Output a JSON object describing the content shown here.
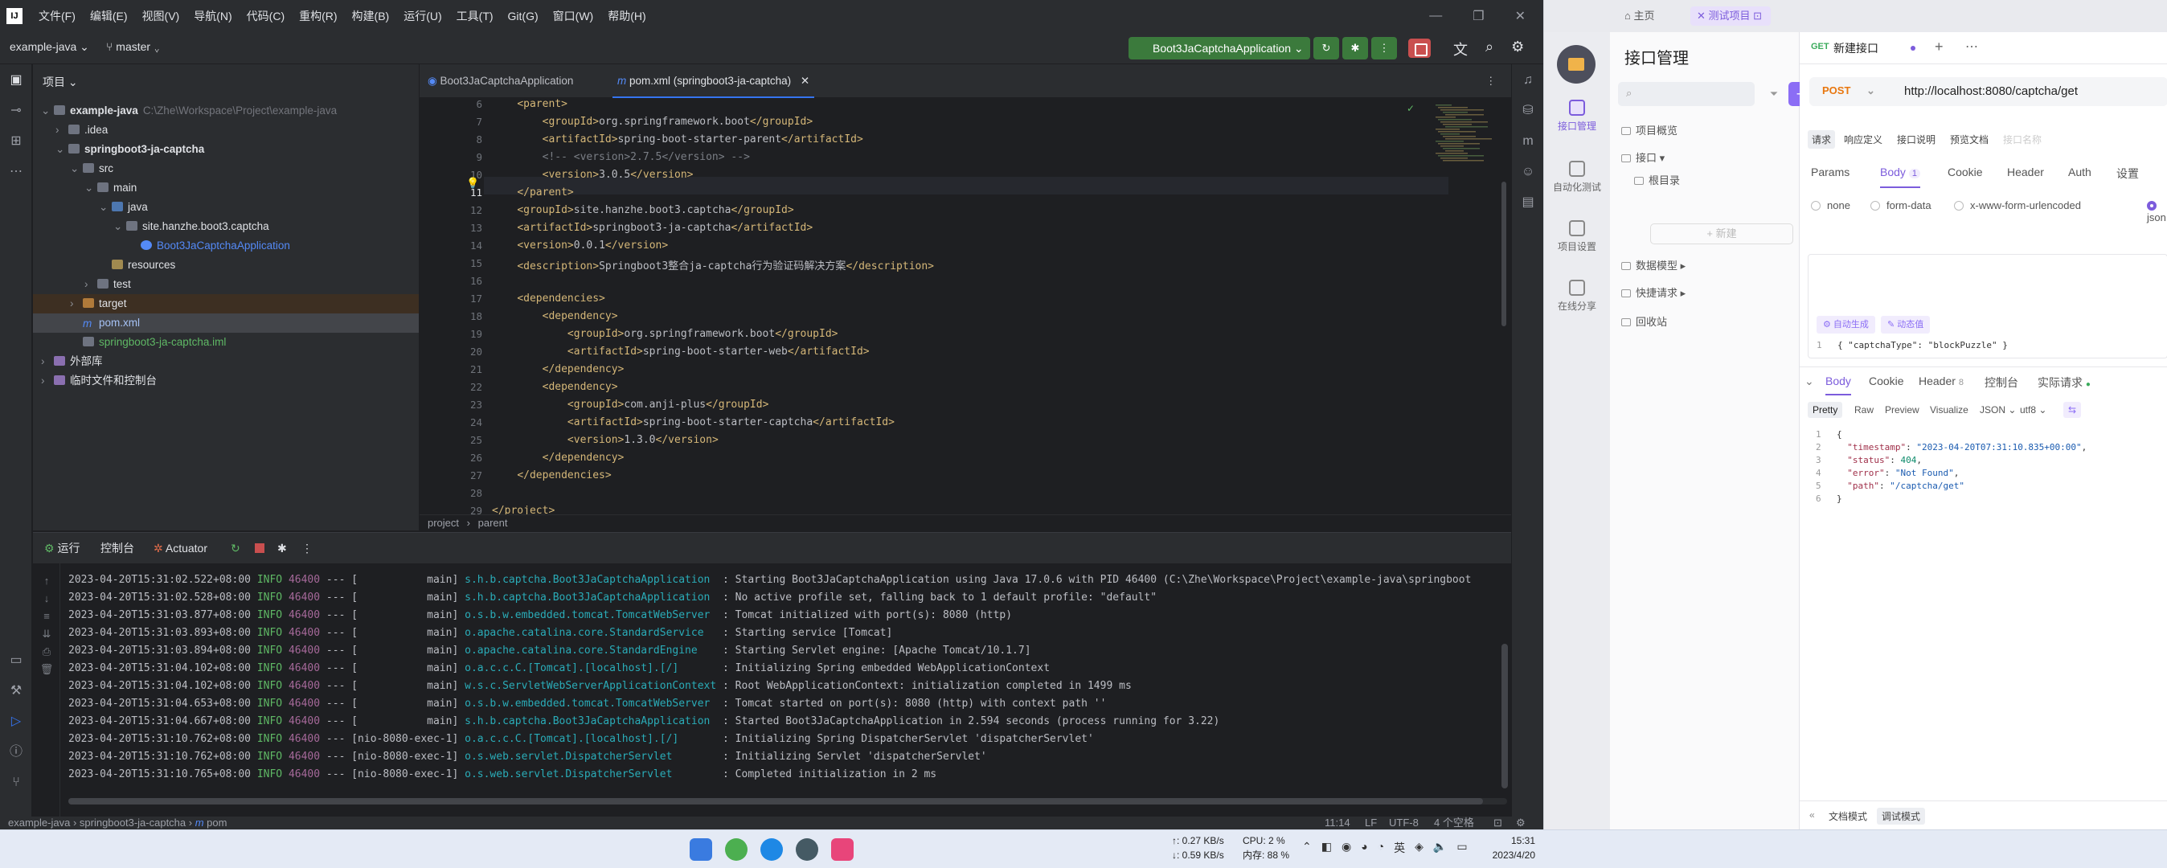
{
  "ide": {
    "menu": [
      "文件(F)",
      "编辑(E)",
      "视图(V)",
      "导航(N)",
      "代码(C)",
      "重构(R)",
      "构建(B)",
      "运行(U)",
      "工具(T)",
      "Git(G)",
      "窗口(W)",
      "帮助(H)"
    ],
    "project": "example-java",
    "branch": "master",
    "run_config": "Boot3JaCaptchaApplication",
    "project_panel_title": "项目",
    "tree": [
      {
        "label": "example-java",
        "sub": "C:\\Zhe\\Workspace\\Project\\example-java",
        "indent": 0,
        "ar": "v",
        "ic": "fold",
        "bold": true
      },
      {
        "label": ".idea",
        "indent": 1,
        "ar": ">",
        "ic": "fold"
      },
      {
        "label": "springboot3-ja-captcha",
        "indent": 1,
        "ar": "v",
        "ic": "fold",
        "bold": true
      },
      {
        "label": "src",
        "indent": 2,
        "ar": "v",
        "ic": "fold"
      },
      {
        "label": "main",
        "indent": 3,
        "ar": "v",
        "ic": "fold"
      },
      {
        "label": "java",
        "indent": 4,
        "ar": "v",
        "ic": "fold-src"
      },
      {
        "label": "site.hanzhe.boot3.captcha",
        "indent": 5,
        "ar": "v",
        "ic": "fold"
      },
      {
        "label": "Boot3JaCaptchaApplication",
        "indent": 6,
        "ar": "",
        "ic": "cls"
      },
      {
        "label": "resources",
        "indent": 4,
        "ar": "",
        "ic": "fold-res"
      },
      {
        "label": "test",
        "indent": 3,
        "ar": ">",
        "ic": "fold"
      },
      {
        "label": "target",
        "indent": 2,
        "ar": ">",
        "ic": "fold-tgt",
        "row": "tgt"
      },
      {
        "label": "pom.xml",
        "indent": 2,
        "ar": "",
        "ic": "m",
        "row": "sel"
      },
      {
        "label": "springboot3-ja-captcha.iml",
        "indent": 2,
        "ar": "",
        "ic": "iml"
      },
      {
        "label": "外部库",
        "indent": 0,
        "ar": ">",
        "ic": "lib"
      },
      {
        "label": "临时文件和控制台",
        "indent": 0,
        "ar": ">",
        "ic": "scratch"
      }
    ],
    "tabs": [
      {
        "label": "Boot3JaCaptchaApplication"
      },
      {
        "label": "pom.xml (springboot3-ja-captcha)"
      }
    ],
    "code": [
      {
        "n": "6",
        "t": "    <parent>"
      },
      {
        "n": "7",
        "t": "        <groupId>org.springframework.boot</groupId>"
      },
      {
        "n": "8",
        "t": "        <artifactId>spring-boot-starter-parent</artifactId>"
      },
      {
        "n": "9",
        "t": "        <!-- <version>2.7.5</version> -->"
      },
      {
        "n": "10",
        "t": "        <version>3.0.5</version>"
      },
      {
        "n": "11",
        "t": "    </parent>"
      },
      {
        "n": "12",
        "t": "    <groupId>site.hanzhe.boot3.captcha</groupId>"
      },
      {
        "n": "13",
        "t": "    <artifactId>springboot3-ja-captcha</artifactId>"
      },
      {
        "n": "14",
        "t": "    <version>0.0.1</version>"
      },
      {
        "n": "15",
        "t": "    <description>Springboot3整合ja-captcha行为验证码解决方案</description>"
      },
      {
        "n": "16",
        "t": ""
      },
      {
        "n": "17",
        "t": "    <dependencies>"
      },
      {
        "n": "18",
        "t": "        <dependency>"
      },
      {
        "n": "19",
        "t": "            <groupId>org.springframework.boot</groupId>"
      },
      {
        "n": "20",
        "t": "            <artifactId>spring-boot-starter-web</artifactId>"
      },
      {
        "n": "21",
        "t": "        </dependency>"
      },
      {
        "n": "22",
        "t": "        <dependency>"
      },
      {
        "n": "23",
        "t": "            <groupId>com.anji-plus</groupId>"
      },
      {
        "n": "24",
        "t": "            <artifactId>spring-boot-starter-captcha</artifactId>"
      },
      {
        "n": "25",
        "t": "            <version>1.3.0</version>"
      },
      {
        "n": "26",
        "t": "        </dependency>"
      },
      {
        "n": "27",
        "t": "    </dependencies>"
      },
      {
        "n": "28",
        "t": ""
      },
      {
        "n": "29",
        "t": "</project>"
      }
    ],
    "breadcrumb": [
      "project",
      "parent"
    ],
    "run_tabs": [
      "运行",
      "控制台",
      "Actuator"
    ],
    "logs": [
      {
        "ts": "2023-04-20T15:31:02.522+08:00",
        "lv": "INFO",
        "pid": "46400",
        "th": "--- [           main]",
        "cls": "s.h.b.captcha.Boot3JaCaptchaApplication ",
        "msg": ": Starting Boot3JaCaptchaApplication using Java 17.0.6 with PID 46400 (C:\\Zhe\\Workspace\\Project\\example-java\\springboot"
      },
      {
        "ts": "2023-04-20T15:31:02.528+08:00",
        "lv": "INFO",
        "pid": "46400",
        "th": "--- [           main]",
        "cls": "s.h.b.captcha.Boot3JaCaptchaApplication ",
        "msg": ": No active profile set, falling back to 1 default profile: \"default\""
      },
      {
        "ts": "2023-04-20T15:31:03.877+08:00",
        "lv": "INFO",
        "pid": "46400",
        "th": "--- [           main]",
        "cls": "o.s.b.w.embedded.tomcat.TomcatWebServer ",
        "msg": ": Tomcat initialized with port(s): 8080 (http)"
      },
      {
        "ts": "2023-04-20T15:31:03.893+08:00",
        "lv": "INFO",
        "pid": "46400",
        "th": "--- [           main]",
        "cls": "o.apache.catalina.core.StandardService  ",
        "msg": ": Starting service [Tomcat]"
      },
      {
        "ts": "2023-04-20T15:31:03.894+08:00",
        "lv": "INFO",
        "pid": "46400",
        "th": "--- [           main]",
        "cls": "o.apache.catalina.core.StandardEngine   ",
        "msg": ": Starting Servlet engine: [Apache Tomcat/10.1.7]"
      },
      {
        "ts": "2023-04-20T15:31:04.102+08:00",
        "lv": "INFO",
        "pid": "46400",
        "th": "--- [           main]",
        "cls": "o.a.c.c.C.[Tomcat].[localhost].[/]      ",
        "msg": ": Initializing Spring embedded WebApplicationContext"
      },
      {
        "ts": "2023-04-20T15:31:04.102+08:00",
        "lv": "INFO",
        "pid": "46400",
        "th": "--- [           main]",
        "cls": "w.s.c.ServletWebServerApplicationContext",
        "msg": ": Root WebApplicationContext: initialization completed in 1499 ms"
      },
      {
        "ts": "2023-04-20T15:31:04.653+08:00",
        "lv": "INFO",
        "pid": "46400",
        "th": "--- [           main]",
        "cls": "o.s.b.w.embedded.tomcat.TomcatWebServer ",
        "msg": ": Tomcat started on port(s): 8080 (http) with context path ''"
      },
      {
        "ts": "2023-04-20T15:31:04.667+08:00",
        "lv": "INFO",
        "pid": "46400",
        "th": "--- [           main]",
        "cls": "s.h.b.captcha.Boot3JaCaptchaApplication ",
        "msg": ": Started Boot3JaCaptchaApplication in 2.594 seconds (process running for 3.22)"
      },
      {
        "ts": "2023-04-20T15:31:10.762+08:00",
        "lv": "INFO",
        "pid": "46400",
        "th": "--- [nio-8080-exec-1]",
        "cls": "o.a.c.c.C.[Tomcat].[localhost].[/]      ",
        "msg": ": Initializing Spring DispatcherServlet 'dispatcherServlet'"
      },
      {
        "ts": "2023-04-20T15:31:10.762+08:00",
        "lv": "INFO",
        "pid": "46400",
        "th": "--- [nio-8080-exec-1]",
        "cls": "o.s.web.servlet.DispatcherServlet       ",
        "msg": ": Initializing Servlet 'dispatcherServlet'"
      },
      {
        "ts": "2023-04-20T15:31:10.765+08:00",
        "lv": "INFO",
        "pid": "46400",
        "th": "--- [nio-8080-exec-1]",
        "cls": "o.s.web.servlet.DispatcherServlet       ",
        "msg": ": Completed initialization in 2 ms"
      }
    ],
    "status": {
      "path": [
        "example-java",
        "springboot3-ja-captcha",
        "pom"
      ],
      "pos": "11:14",
      "eol": "LF",
      "enc": "UTF-8",
      "indent": "4 个空格"
    }
  },
  "api": {
    "home_tab": "主页",
    "project_tab": "测试项目",
    "nav": [
      "接口管理",
      "自动化测试",
      "项目设置",
      "在线分享"
    ],
    "title": "接口管理",
    "side": [
      "项目概览",
      "接口",
      "根目录",
      "新建",
      "数据模型",
      "快捷请求",
      "回收站"
    ],
    "req_method": "GET",
    "req_title": "新建接口",
    "method": "POST",
    "url": "http://localhost:8080/captcha/get",
    "subtabs": [
      "请求",
      "响应定义",
      "接口说明",
      "预览文档",
      "接口名称"
    ],
    "ptabs": [
      {
        "l": "Params"
      },
      {
        "l": "Body",
        "c": "1"
      },
      {
        "l": "Cookie"
      },
      {
        "l": "Header"
      },
      {
        "l": "Auth"
      },
      {
        "l": "设置"
      }
    ],
    "radios": [
      "none",
      "form-data",
      "x-www-form-urlencoded",
      "json"
    ],
    "auto_gen": "自动生成",
    "dyn_val": "动态值",
    "body_line": "{ \"captchaType\": \"blockPuzzle\" }",
    "rtabs": [
      {
        "l": "Body"
      },
      {
        "l": "Cookie"
      },
      {
        "l": "Header",
        "c": "8"
      },
      {
        "l": "控制台"
      },
      {
        "l": "实际请求"
      }
    ],
    "fmts": [
      "Pretty",
      "Raw",
      "Preview",
      "Visualize",
      "JSON",
      "utf8"
    ],
    "resp": [
      {
        "n": "1",
        "t": "{"
      },
      {
        "n": "2",
        "k": "\"timestamp\"",
        "v": "\"2023-04-20T07:31:10.835+00:00\"",
        "c": ","
      },
      {
        "n": "3",
        "k": "\"status\"",
        "v": "404",
        "c": ",",
        "num": true
      },
      {
        "n": "4",
        "k": "\"error\"",
        "v": "\"Not Found\"",
        "c": ","
      },
      {
        "n": "5",
        "k": "\"path\"",
        "v": "\"/captcha/get\"",
        "c": ""
      },
      {
        "n": "6",
        "t": "}"
      }
    ],
    "bottom": [
      "文档模式",
      "调试模式"
    ]
  },
  "taskbar": {
    "net_up": "↑: 0.27 KB/s",
    "net_down": "↓: 0.59 KB/s",
    "cpu": "CPU: 2 %",
    "mem": "内存: 88 %",
    "ime": "英",
    "time": "15:31",
    "date": "2023/4/20"
  }
}
